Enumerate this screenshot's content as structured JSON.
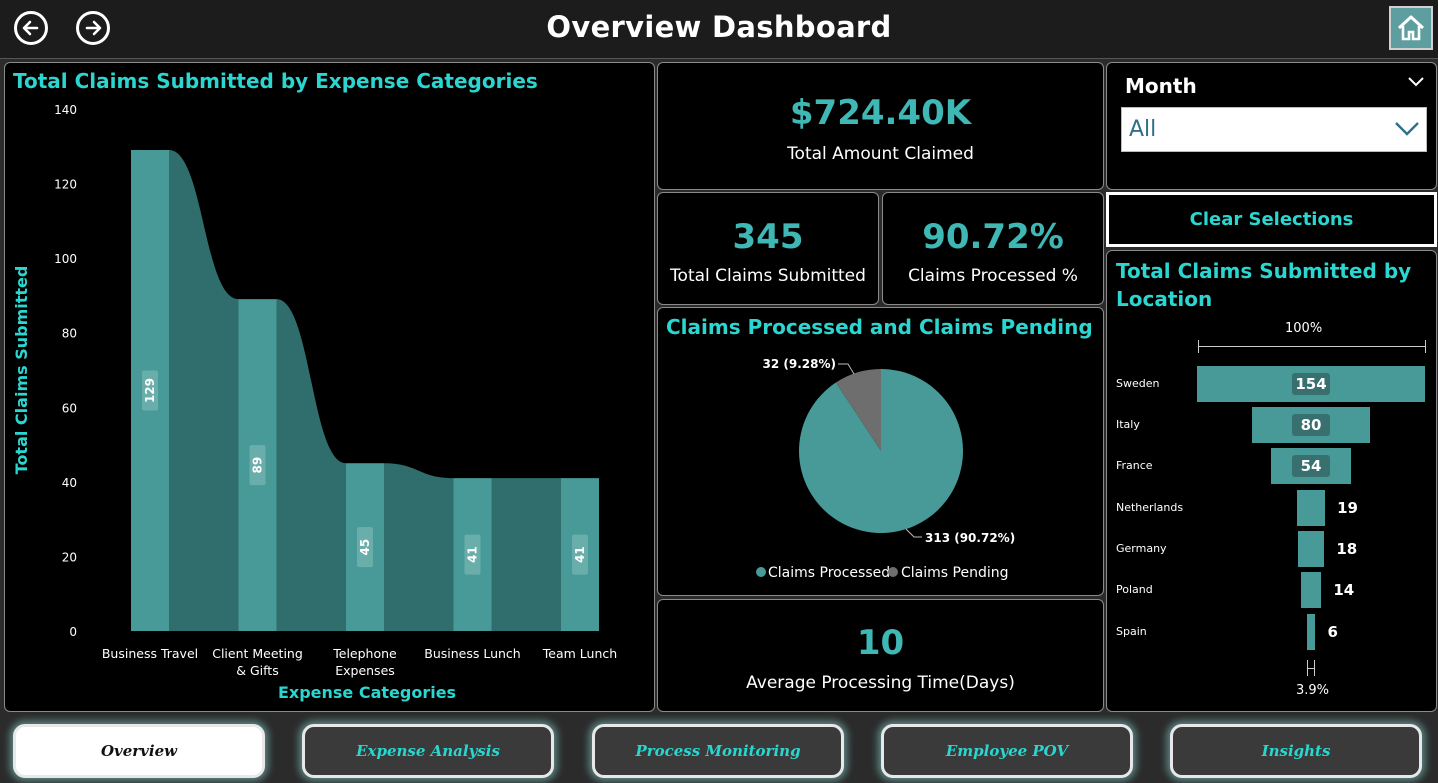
{
  "header": {
    "title": "Overview Dashboard"
  },
  "icons": {
    "back": "arrow-left-icon",
    "forward": "arrow-right-icon",
    "home": "home-icon"
  },
  "colors": {
    "accent": "#2ad6cf",
    "bar": "#479a98",
    "ribbon": "#2f6e6c",
    "pending": "#6e6e6e"
  },
  "kpis": {
    "total_amount": {
      "value": "$724.40K",
      "label": "Total Amount Claimed"
    },
    "total_claims": {
      "value": "345",
      "label": "Total Claims Submitted"
    },
    "processed_pct": {
      "value": "90.72%",
      "label": "Claims Processed %"
    },
    "avg_time": {
      "value": "10",
      "label": "Average Processing Time(Days)"
    }
  },
  "filter": {
    "label": "Month",
    "selected": "All"
  },
  "clear_button": "Clear Selections",
  "tabs": [
    "Overview",
    "Expense Analysis",
    "Process Monitoring",
    "Employee POV",
    "Insights"
  ],
  "active_tab": "Overview",
  "chart_data": [
    {
      "type": "bar",
      "title": "Total Claims Submitted by Expense Categories",
      "xlabel": "Expense Categories",
      "ylabel": "Total Claims Submitted",
      "categories": [
        "Business Travel",
        "Client Meeting & Gifts",
        "Telephone Expenses",
        "Business Lunch",
        "Team Lunch"
      ],
      "category_lines": [
        [
          "Business Travel"
        ],
        [
          "Client Meeting",
          "& Gifts"
        ],
        [
          "Telephone",
          "Expenses"
        ],
        [
          "Business Lunch"
        ],
        [
          "Team Lunch"
        ]
      ],
      "values": [
        129,
        89,
        45,
        41,
        41
      ],
      "ylim": [
        0,
        140
      ],
      "yticks": [
        0,
        20,
        40,
        60,
        80,
        100,
        120,
        140
      ]
    },
    {
      "type": "pie",
      "title": "Claims Processed and Claims Pending",
      "labels": [
        "Claims Processed",
        "Claims Pending"
      ],
      "values": [
        313,
        32
      ],
      "data_labels": [
        "313 (90.72%)",
        "32 (9.28%)"
      ],
      "legend": "bottom"
    },
    {
      "type": "bar",
      "subtype": "funnel",
      "title": "Total Claims Submitted by Location",
      "categories": [
        "Sweden",
        "Italy",
        "France",
        "Netherlands",
        "Germany",
        "Poland",
        "Spain"
      ],
      "values": [
        154,
        80,
        54,
        19,
        18,
        14,
        6
      ],
      "top_label": "100%",
      "bottom_label": "3.9%"
    }
  ]
}
